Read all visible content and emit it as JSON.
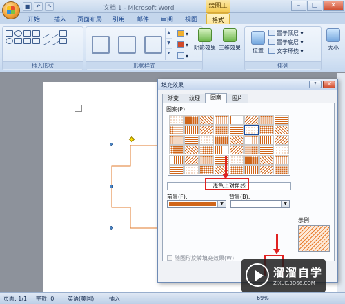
{
  "window": {
    "title": "文档 1 - Microsoft Word",
    "context_tool": "绘图工具",
    "controls": [
      "–",
      "□",
      "✕"
    ]
  },
  "quick_access": [
    "save",
    "undo",
    "redo"
  ],
  "tabs": [
    "开始",
    "插入",
    "页面布局",
    "引用",
    "邮件",
    "审阅",
    "视图",
    "格式"
  ],
  "ribbon": {
    "groups": {
      "insert_shapes": "插入形状",
      "shape_styles": "形状样式",
      "arrange": "排列"
    },
    "style_swatch_colors": [
      "#000000",
      "#4f81bd",
      "#c0504d"
    ],
    "buttons": {
      "shadow": "阴影效果",
      "threed": "三维效果",
      "position": "位置",
      "bring_front": "置于顶层",
      "send_back": "置于底层",
      "text_wrap": "文字环绕",
      "size": "大小"
    }
  },
  "dialog": {
    "title": "填充效果",
    "title_buttons": [
      "?",
      "X"
    ],
    "tabs": [
      "渐变",
      "纹理",
      "图案",
      "图片"
    ],
    "active_tab": "图案",
    "pattern_label": "图案(P):",
    "pattern_name": "浅色上对角线",
    "foreground_label": "前景(F):",
    "background_label": "背景(B):",
    "foreground_color": "#d0661a",
    "example_label": "示例:",
    "rotate_checkbox": "随图形旋转填充效果(W)"
  },
  "statusbar": {
    "page": "页面: 1/1",
    "words": "字数: 0",
    "language": "英语(美国)",
    "mode": "插入",
    "zoom": "69%"
  },
  "watermark": {
    "text": "溜溜自学",
    "url": "ZIXUE.3D66.COM"
  }
}
